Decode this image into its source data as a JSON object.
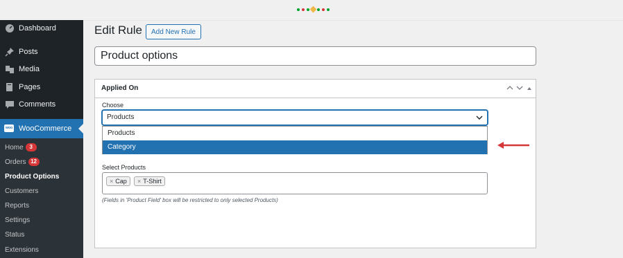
{
  "sidebar": {
    "items": [
      {
        "label": "Dashboard",
        "icon": "dashboard-icon"
      },
      {
        "label": "Posts",
        "icon": "pin-icon"
      },
      {
        "label": "Media",
        "icon": "media-icon"
      },
      {
        "label": "Pages",
        "icon": "pages-icon"
      },
      {
        "label": "Comments",
        "icon": "comment-icon"
      }
    ],
    "woocommerce": {
      "label": "WooCommerce",
      "logo_text": "woo"
    },
    "submenu": [
      {
        "label": "Home",
        "badge": "3"
      },
      {
        "label": "Orders",
        "badge": "12"
      },
      {
        "label": "Product Options"
      },
      {
        "label": "Customers"
      },
      {
        "label": "Reports"
      },
      {
        "label": "Settings"
      },
      {
        "label": "Status"
      },
      {
        "label": "Extensions"
      }
    ]
  },
  "page": {
    "title": "Edit Rule",
    "add_new_label": "Add New Rule",
    "rule_title": "Product options"
  },
  "postbox": {
    "title": "Applied On",
    "choose_label": "Choose",
    "selected": "Products",
    "options": [
      "Products",
      "Category"
    ],
    "highlighted_option": "Category",
    "select_products_label": "Select Products",
    "chips": [
      "Cap",
      "T-Shirt"
    ],
    "hint": "(Fields in 'Product Field' box will be restricted to only selected Products)"
  },
  "colors": {
    "accent": "#2271b1",
    "sidebar_bg": "#1d2327",
    "badge": "#d63638",
    "arrow": "#d63638"
  }
}
